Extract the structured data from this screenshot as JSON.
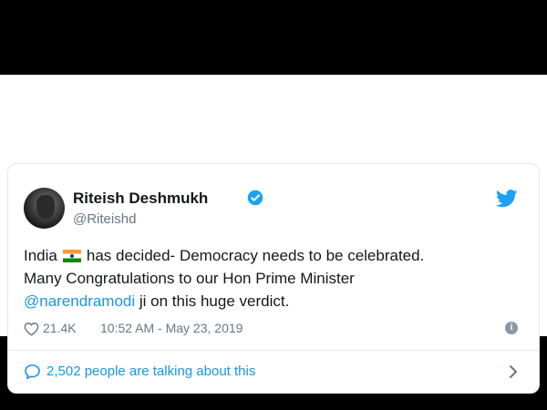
{
  "tweet": {
    "display_name": "Riteish Deshmukh",
    "handle": "@Riteishd",
    "text_line1_before_flag": "India",
    "text_line1_after_flag": "has decided- Democracy needs to be celebrated.",
    "text_line2": "Many Congratulations to our Hon Prime Minister",
    "mention": "@narendramodi",
    "text_line3_after_mention": " ji on this huge verdict.",
    "likes": "21.4K",
    "timestamp": "10:52 AM - May 23, 2019",
    "talking": "2,502 people are talking about this"
  },
  "icons": {
    "verified": "verified-badge-icon",
    "logo": "twitter-bird-icon",
    "like": "heart-icon",
    "info": "info-icon",
    "reply": "speech-bubble-icon",
    "chevron": "chevron-right-icon",
    "flag": "india-flag-emoji"
  },
  "colors": {
    "accent": "#1da1f2",
    "link": "#1b95e0",
    "text": "#14171a",
    "muted": "#657786"
  }
}
